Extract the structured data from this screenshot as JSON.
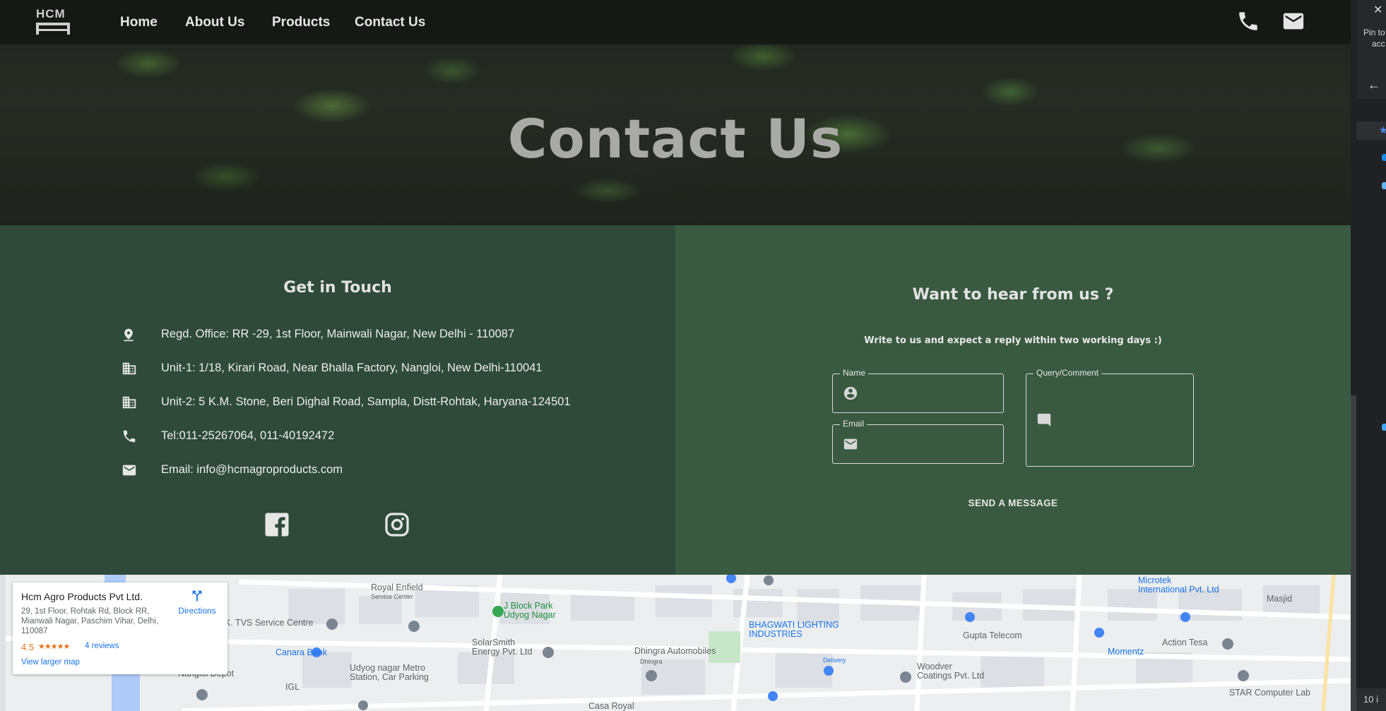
{
  "nav": {
    "logo_text": "HCM",
    "links": [
      "Home",
      "About Us",
      "Products",
      "Contact Us"
    ]
  },
  "hero": {
    "title": "Contact Us"
  },
  "get_in_touch": {
    "heading": "Get in Touch",
    "items": [
      {
        "icon": "location-pin-icon",
        "text": "Regd. Office: RR -29, 1st Floor, Mainwali Nagar, New Delhi - 110087"
      },
      {
        "icon": "building-icon",
        "text": "Unit-1: 1/18, Kirari Road, Near Bhalla Factory, Nangloi, New Delhi-110041"
      },
      {
        "icon": "building-icon",
        "text": "Unit-2: 5 K.M. Stone, Beri Dighal Road, Sampla, Distt-Rohtak, Haryana-124501"
      },
      {
        "icon": "phone-icon",
        "text": "Tel:011-25267064, 011-40192472"
      },
      {
        "icon": "email-icon",
        "text": "Email: info@hcmagroproducts.com"
      }
    ]
  },
  "form": {
    "heading": "Want to hear from us ?",
    "subtext": "Write to us and expect a reply within two working days :)",
    "name_label": "Name",
    "email_label": "Email",
    "query_label": "Query/Comment",
    "send_label": "SEND A MESSAGE"
  },
  "map": {
    "place_name": "Hcm Agro Products Pvt Ltd.",
    "address": "29, 1st Floor, Rohtak Rd, Block RR, Mianwali Nagar, Paschim Vihar, Delhi, 110087",
    "rating": "4.5",
    "reviews": "4 reviews",
    "directions": "Directions",
    "larger_map": "View larger map",
    "labels": [
      {
        "text": "Royal Enfield",
        "sub": "Service Center"
      },
      {
        "text": "J Block Park",
        "sub": "Udyog Nagar"
      },
      {
        "text": "BHAGWATI LIGHTING",
        "sub": "INDUSTRIES"
      },
      {
        "text": "Microtek",
        "sub": "International Pvt. Ltd"
      },
      {
        "text": "Masjid",
        "sub": ""
      },
      {
        "text": "K. TVS Service Centre",
        "sub": ""
      },
      {
        "text": "Canara Bank",
        "sub": ""
      },
      {
        "text": "SolarSmith",
        "sub": "Energy Pvt. Ltd"
      },
      {
        "text": "Dhingra Automobiles",
        "sub": ""
      },
      {
        "text": "Gupta Telecom",
        "sub": ""
      },
      {
        "text": "Action Tesa",
        "sub": ""
      },
      {
        "text": "Momentz",
        "sub": ""
      },
      {
        "text": "Udyog nagar Metro",
        "sub": "Station, Car Parking"
      },
      {
        "text": "Woodver",
        "sub": "Coatings Pvt. Ltd"
      },
      {
        "text": "Nangloi Depot",
        "sub": ""
      },
      {
        "text": "IGL",
        "sub": ""
      },
      {
        "text": "STAR Computer Lab",
        "sub": ""
      },
      {
        "text": "Casa Royal",
        "sub": ""
      },
      {
        "text": "Dhingra",
        "sub": ""
      },
      {
        "text": "Delivery",
        "sub": ""
      }
    ]
  },
  "browser_side": {
    "pin_line1": "Pin to",
    "pin_line2": "acc",
    "bottom": "10 i"
  },
  "colors": {
    "left_panel": "#2f4a3b",
    "right_panel": "#3a5941",
    "navbar": "#141614",
    "text_light": "#e6e6e6"
  }
}
